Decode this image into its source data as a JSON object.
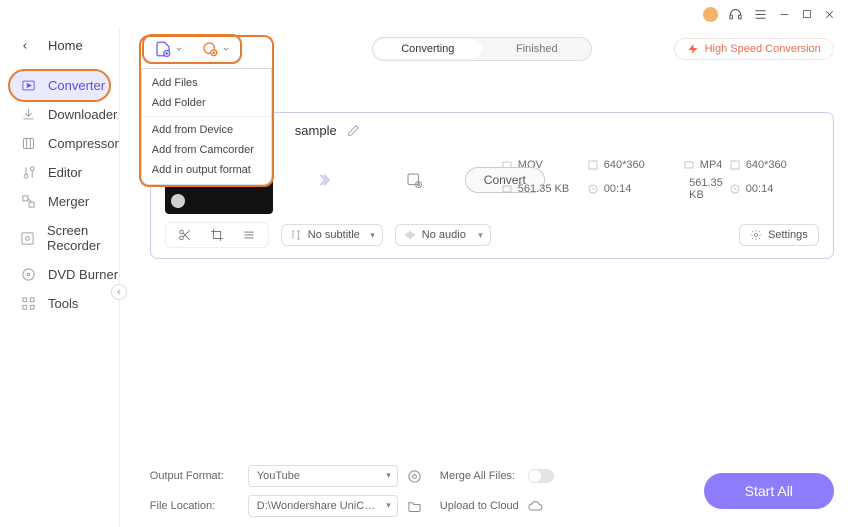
{
  "titlebar": {
    "user_initial": ""
  },
  "home_label": "Home",
  "nav": [
    {
      "label": "Converter",
      "active": true
    },
    {
      "label": "Downloader",
      "active": false
    },
    {
      "label": "Compressor",
      "active": false
    },
    {
      "label": "Editor",
      "active": false
    },
    {
      "label": "Merger",
      "active": false
    },
    {
      "label": "Screen Recorder",
      "active": false
    },
    {
      "label": "DVD Burner",
      "active": false
    },
    {
      "label": "Tools",
      "active": false
    }
  ],
  "tabs": {
    "left": "Converting",
    "right": "Finished"
  },
  "high_speed_label": "High Speed Conversion",
  "dropdown": {
    "items": [
      "Add Files",
      "Add Folder",
      "Add from Device",
      "Add from Camcorder",
      "Add in output format"
    ]
  },
  "card": {
    "title": "sample",
    "src": {
      "format": "MOV",
      "res": "640*360",
      "size": "561.35 KB",
      "dur": "00:14"
    },
    "dst": {
      "format": "MP4",
      "res": "640*360",
      "size": "561.35 KB",
      "dur": "00:14"
    },
    "convert_label": "Convert",
    "subtitle": "No subtitle",
    "audio": "No audio",
    "settings_label": "Settings"
  },
  "footer": {
    "output_format_label": "Output Format:",
    "output_format_value": "YouTube",
    "file_location_label": "File Location:",
    "file_location_value": "D:\\Wondershare UniConverter 1",
    "merge_label": "Merge All Files:",
    "upload_label": "Upload to Cloud",
    "start_all_label": "Start All"
  }
}
